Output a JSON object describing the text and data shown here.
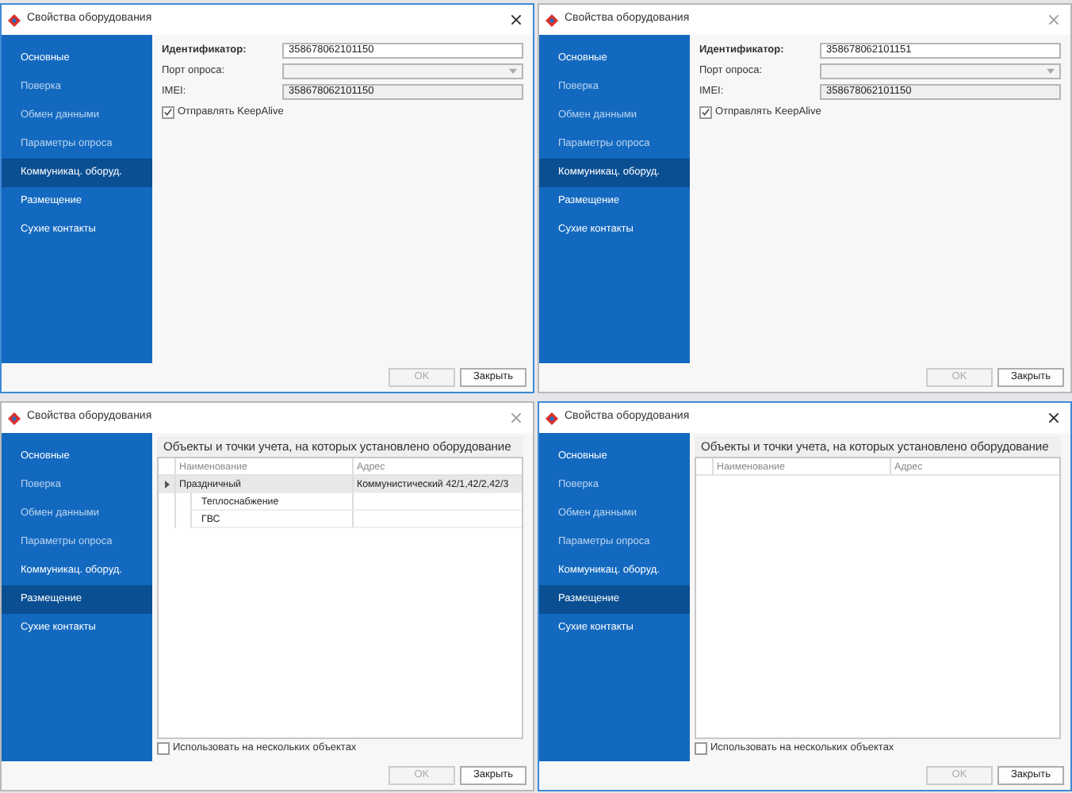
{
  "windows": [
    {
      "title": "Свойства оборудования",
      "active": true,
      "kind": "form",
      "sidebar": [
        {
          "label": "Основные",
          "selected": false,
          "dimmed": false
        },
        {
          "label": "Поверка",
          "selected": false,
          "dimmed": true
        },
        {
          "label": "Обмен данными",
          "selected": false,
          "dimmed": true
        },
        {
          "label": "Параметры опроса",
          "selected": false,
          "dimmed": true
        },
        {
          "label": "Коммуникац. оборуд.",
          "selected": true,
          "dimmed": false
        },
        {
          "label": "Размещение",
          "selected": false,
          "dimmed": false
        },
        {
          "label": "Сухие контакты",
          "selected": false,
          "dimmed": false
        }
      ],
      "fields": [
        {
          "label": "Идентификатор:",
          "kind": "text",
          "required": true,
          "value": "358678062101150"
        },
        {
          "label": "Порт опроса:",
          "kind": "select",
          "required": false
        },
        {
          "label": "IMEI:",
          "kind": "readonly",
          "required": false,
          "value": "358678062101150"
        }
      ],
      "checkbox": {
        "label": "Отправлять KeepAlive",
        "checked": true
      },
      "buttons": [
        {
          "label": "OK",
          "disabled": true
        },
        {
          "label": "Закрыть",
          "disabled": false
        }
      ]
    },
    {
      "title": "Свойства оборудования",
      "active": false,
      "kind": "form",
      "sidebar": [
        {
          "label": "Основные",
          "selected": false,
          "dimmed": false
        },
        {
          "label": "Поверка",
          "selected": false,
          "dimmed": true
        },
        {
          "label": "Обмен данными",
          "selected": false,
          "dimmed": true
        },
        {
          "label": "Параметры опроса",
          "selected": false,
          "dimmed": true
        },
        {
          "label": "Коммуникац. оборуд.",
          "selected": true,
          "dimmed": false
        },
        {
          "label": "Размещение",
          "selected": false,
          "dimmed": false
        },
        {
          "label": "Сухие контакты",
          "selected": false,
          "dimmed": false
        }
      ],
      "fields": [
        {
          "label": "Идентификатор:",
          "kind": "text",
          "required": true,
          "value": "358678062101151"
        },
        {
          "label": "Порт опроса:",
          "kind": "select",
          "required": false
        },
        {
          "label": "IMEI:",
          "kind": "readonly",
          "required": false,
          "value": "358678062101150"
        }
      ],
      "checkbox": {
        "label": "Отправлять KeepAlive",
        "checked": true
      },
      "buttons": [
        {
          "label": "OK",
          "disabled": true
        },
        {
          "label": "Закрыть",
          "disabled": false
        }
      ]
    },
    {
      "title": "Свойства оборудования",
      "active": false,
      "kind": "placement",
      "sidebar": [
        {
          "label": "Основные",
          "selected": false,
          "dimmed": false
        },
        {
          "label": "Поверка",
          "selected": false,
          "dimmed": true
        },
        {
          "label": "Обмен данными",
          "selected": false,
          "dimmed": true
        },
        {
          "label": "Параметры опроса",
          "selected": false,
          "dimmed": true
        },
        {
          "label": "Коммуникац. оборуд.",
          "selected": false,
          "dimmed": false
        },
        {
          "label": "Размещение",
          "selected": true,
          "dimmed": false
        },
        {
          "label": "Сухие контакты",
          "selected": false,
          "dimmed": false
        }
      ],
      "heading": "Объекты и точки учета, на которых установлено оборудование",
      "columns": [
        "Наименование",
        "Адрес"
      ],
      "rows": [
        {
          "name": "Праздничный",
          "address": "Коммунистический 42/1,42/2,42/3",
          "selected": true,
          "children": [
            {
              "name": "Теплоснабжение",
              "selected": false
            },
            {
              "name": "ГВС",
              "selected": false
            }
          ]
        }
      ],
      "checkbox": {
        "label": "Использовать на нескольких объектах",
        "checked": false
      },
      "buttons": [
        {
          "label": "OK",
          "disabled": true
        },
        {
          "label": "Закрыть",
          "disabled": false
        }
      ]
    },
    {
      "title": "Свойства оборудования",
      "active": true,
      "kind": "placement",
      "sidebar": [
        {
          "label": "Основные",
          "selected": false,
          "dimmed": false
        },
        {
          "label": "Поверка",
          "selected": false,
          "dimmed": true
        },
        {
          "label": "Обмен данными",
          "selected": false,
          "dimmed": true
        },
        {
          "label": "Параметры опроса",
          "selected": false,
          "dimmed": true
        },
        {
          "label": "Коммуникац. оборуд.",
          "selected": false,
          "dimmed": false
        },
        {
          "label": "Размещение",
          "selected": true,
          "dimmed": false
        },
        {
          "label": "Сухие контакты",
          "selected": false,
          "dimmed": false
        }
      ],
      "heading": "Объекты и точки учета, на которых установлено оборудование",
      "columns": [
        "Наименование",
        "Адрес"
      ],
      "checkbox": {
        "label": "Использовать на нескольких объектах",
        "checked": false
      },
      "buttons": [
        {
          "label": "OK",
          "disabled": true
        },
        {
          "label": "Закрыть",
          "disabled": false
        }
      ]
    }
  ]
}
